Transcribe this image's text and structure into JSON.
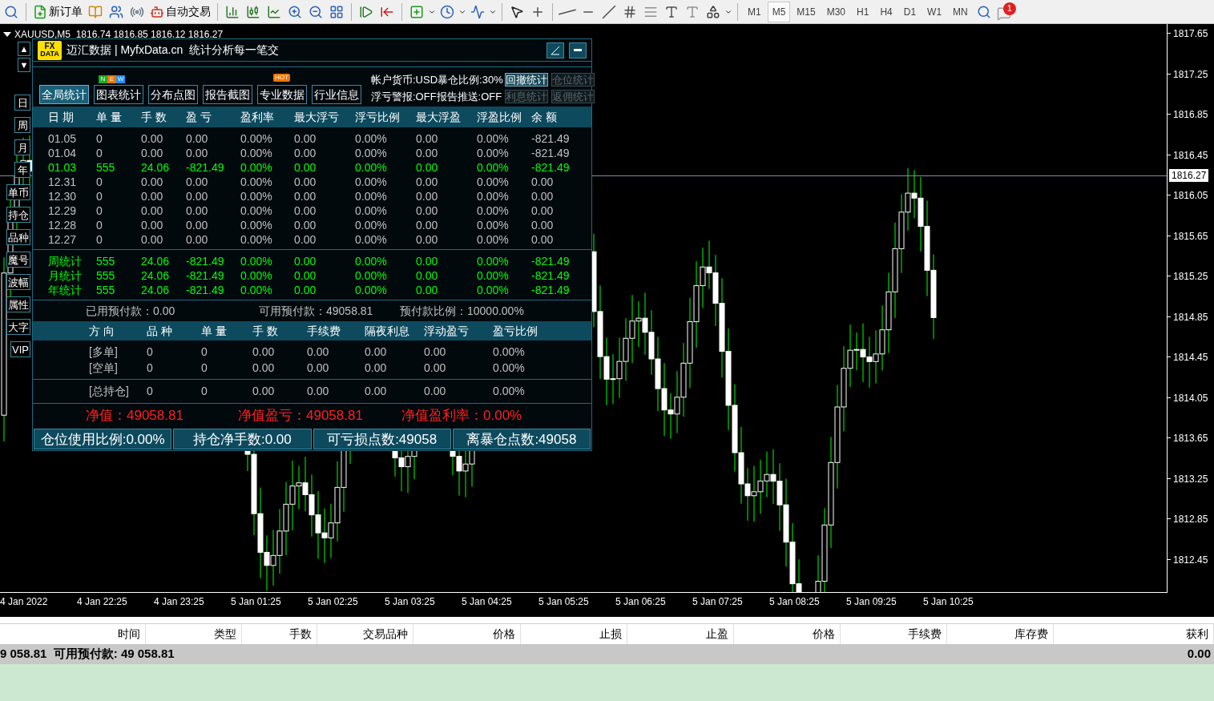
{
  "toolbar": {
    "new_order": "新订单",
    "auto_trading": "自动交易",
    "timeframes": [
      {
        "label": "M1",
        "selected": false
      },
      {
        "label": "M5",
        "selected": true
      },
      {
        "label": "M15",
        "selected": false
      },
      {
        "label": "M30",
        "selected": false
      },
      {
        "label": "H1",
        "selected": false
      },
      {
        "label": "H4",
        "selected": false
      },
      {
        "label": "D1",
        "selected": false
      },
      {
        "label": "W1",
        "selected": false
      },
      {
        "label": "MN",
        "selected": false
      }
    ],
    "notifications": "1"
  },
  "chart": {
    "title": "XAUUSD,M5  1816.74 1816.85 1816.12 1816.27",
    "current_price": "1816.27",
    "price_axis": [
      "1817.65",
      "1817.25",
      "1816.85",
      "1816.45",
      "1816.05",
      "1815.65",
      "1815.25",
      "1814.85",
      "1814.45",
      "1814.05",
      "1813.65",
      "1813.25",
      "1812.85",
      "1812.45"
    ],
    "time_axis": [
      "4 Jan 2022",
      "4 Jan 22:25",
      "4 Jan 23:25",
      "5 Jan 01:25",
      "5 Jan 02:25",
      "5 Jan 03:25",
      "5 Jan 04:25",
      "5 Jan 05:25",
      "5 Jan 06:25",
      "5 Jan 07:25",
      "5 Jan 08:25",
      "5 Jan 09:25",
      "5 Jan 10:25"
    ]
  },
  "panel": {
    "logo": [
      "FX",
      "DATA"
    ],
    "title": "迈汇数据 | MyfxData.cn  统计分析每一笔交",
    "scroll_buttons": [
      "▲",
      "▼"
    ],
    "side_buttons": [
      "日",
      "周",
      "月",
      "年",
      "单币",
      "持仓",
      "品种",
      "魔号",
      "波幅",
      "属性",
      "大字",
      "VIP"
    ],
    "tabs": [
      {
        "label": "全局统计",
        "selected": true
      },
      {
        "label": "图表统计",
        "selected": false,
        "new_badge": true,
        "hot_badge": false
      },
      {
        "label": "分布点图",
        "selected": false
      },
      {
        "label": "报告截图",
        "selected": false
      },
      {
        "label": "专业数据",
        "selected": false,
        "new_badge": false,
        "hot_badge": true
      },
      {
        "label": "行业信息",
        "selected": false
      }
    ],
    "new_badge": [
      {
        "letter": "N",
        "color": "#22aa22"
      },
      {
        "letter": "E",
        "color": "#ee7700"
      },
      {
        "letter": "W",
        "color": "#1e90ff"
      }
    ],
    "hot_badge": "HOT",
    "info_lines": [
      "帐户货币:USD暴仓比例:30%",
      "浮亏警报:OFF报告推送:OFF"
    ],
    "stat_buttons": [
      [
        {
          "label": "回撤统计",
          "disabled": false
        },
        {
          "label": "仓位统计",
          "disabled": true
        }
      ],
      [
        {
          "label": "利息统计",
          "disabled": true
        },
        {
          "label": "返佣统计",
          "disabled": true
        }
      ]
    ],
    "daily_columns": [
      "日 期",
      "单 量",
      "手 数",
      "盈 亏",
      "盈利率",
      "最大浮亏",
      "浮亏比例",
      "最大浮盈",
      "浮盈比例",
      "余 额"
    ],
    "daily_rows": [
      {
        "highlight": false,
        "cells": [
          "01.05",
          "0",
          "0.00",
          "0.00",
          "0.00%",
          "0.00",
          "0.00%",
          "0.00",
          "0.00%",
          "-821.49"
        ]
      },
      {
        "highlight": false,
        "cells": [
          "01.04",
          "0",
          "0.00",
          "0.00",
          "0.00%",
          "0.00",
          "0.00%",
          "0.00",
          "0.00%",
          "-821.49"
        ]
      },
      {
        "highlight": true,
        "cells": [
          "01.03",
          "555",
          "24.06",
          "-821.49",
          "0.00%",
          "0.00",
          "0.00%",
          "0.00",
          "0.00%",
          "-821.49"
        ]
      },
      {
        "highlight": false,
        "cells": [
          "12.31",
          "0",
          "0.00",
          "0.00",
          "0.00%",
          "0.00",
          "0.00%",
          "0.00",
          "0.00%",
          "0.00"
        ]
      },
      {
        "highlight": false,
        "cells": [
          "12.30",
          "0",
          "0.00",
          "0.00",
          "0.00%",
          "0.00",
          "0.00%",
          "0.00",
          "0.00%",
          "0.00"
        ]
      },
      {
        "highlight": false,
        "cells": [
          "12.29",
          "0",
          "0.00",
          "0.00",
          "0.00%",
          "0.00",
          "0.00%",
          "0.00",
          "0.00%",
          "0.00"
        ]
      },
      {
        "highlight": false,
        "cells": [
          "12.28",
          "0",
          "0.00",
          "0.00",
          "0.00%",
          "0.00",
          "0.00%",
          "0.00",
          "0.00%",
          "0.00"
        ]
      },
      {
        "highlight": false,
        "cells": [
          "12.27",
          "0",
          "0.00",
          "0.00",
          "0.00%",
          "0.00",
          "0.00%",
          "0.00",
          "0.00%",
          "0.00"
        ]
      }
    ],
    "summary_rows": [
      {
        "highlight": true,
        "cells": [
          "周统计",
          "555",
          "24.06",
          "-821.49",
          "0.00%",
          "0.00",
          "0.00%",
          "0.00",
          "0.00%",
          "-821.49"
        ]
      },
      {
        "highlight": true,
        "cells": [
          "月统计",
          "555",
          "24.06",
          "-821.49",
          "0.00%",
          "0.00",
          "0.00%",
          "0.00",
          "0.00%",
          "-821.49"
        ]
      },
      {
        "highlight": true,
        "cells": [
          "年统计",
          "555",
          "24.06",
          "-821.49",
          "0.00%",
          "0.00",
          "0.00%",
          "0.00",
          "0.00%",
          "-821.49"
        ]
      }
    ],
    "margin_line": [
      "已用预付款：0.00",
      "可用预付款：49058.81",
      "预付款比例：10000.00%"
    ],
    "position_columns": [
      "方 向",
      "品 种",
      "单 量",
      "手 数",
      "手续费",
      "隔夜利息",
      "浮动盈亏",
      "盈亏比例"
    ],
    "position_rows": [
      [
        "[多单]",
        "0",
        "0",
        "0.00",
        "0.00",
        "0.00",
        "0.00",
        "0.00%"
      ],
      [
        "[空单]",
        "0",
        "0",
        "0.00",
        "0.00",
        "0.00",
        "0.00",
        "0.00%"
      ]
    ],
    "position_total": [
      "[总持仓]",
      "0",
      "0",
      "0.00",
      "0.00",
      "0.00",
      "0.00",
      "0.00%"
    ],
    "equity_line": [
      "净值：49058.81",
      "净值盈亏：49058.81",
      "净值盈利率：0.00%"
    ],
    "bottom_stats": [
      "仓位使用比例:0.00%",
      "持仓净手数:0.00",
      "可亏损点数:49058",
      "离暴仓点数:49058"
    ]
  },
  "terminal": {
    "columns": [
      "时间",
      "类型",
      "手数",
      "交易品种",
      "价格",
      "止损",
      "止盈",
      "价格",
      "手续费",
      "库存费",
      "获利"
    ],
    "balance": "9 058.81  可用预付款: 49 058.81",
    "profit": "0.00"
  }
}
